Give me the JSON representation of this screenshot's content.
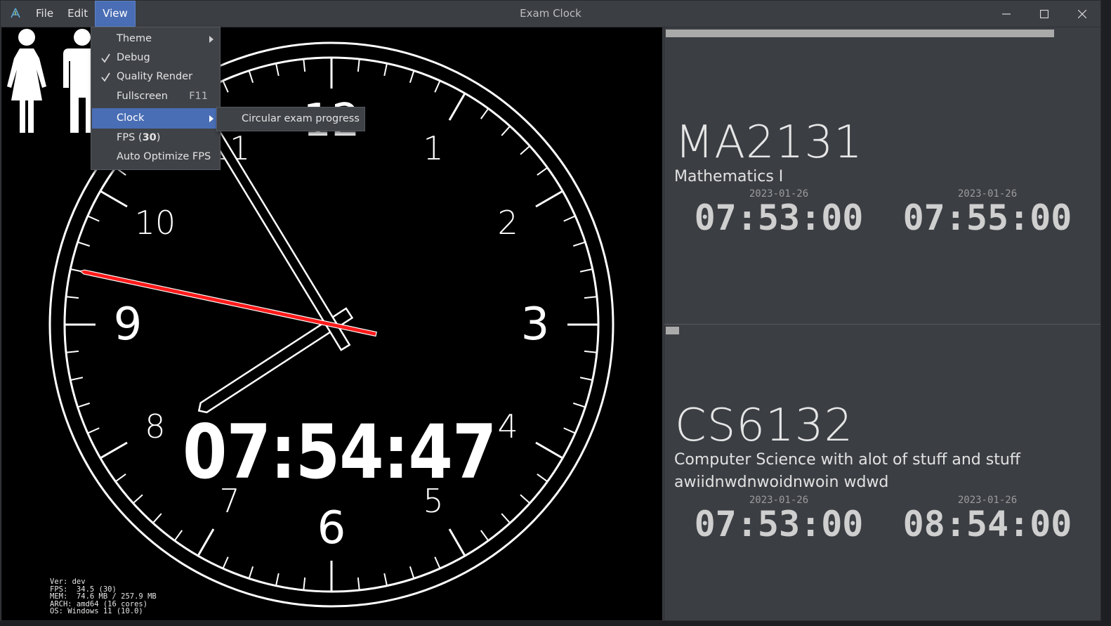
{
  "window": {
    "title": "Exam Clock",
    "icon": "app-logo-icon",
    "controls": [
      "minimize-icon",
      "maximize-icon",
      "close-icon"
    ]
  },
  "menubar": {
    "items": [
      {
        "label": "File"
      },
      {
        "label": "Edit"
      },
      {
        "label": "View",
        "active": true
      }
    ]
  },
  "view_menu": {
    "items": [
      {
        "label": "Theme",
        "checked": false,
        "submenu": true
      },
      {
        "label": "Debug",
        "checked": true
      },
      {
        "label": "Quality Render",
        "checked": true
      },
      {
        "label": "Fullscreen",
        "shortcut": "F11"
      },
      {
        "label": "Clock",
        "submenu": true,
        "highlighted": true
      },
      {
        "label_prefix": "FPS (",
        "label_bold": "30",
        "label_suffix": ")"
      },
      {
        "label": "Auto Optimize FPS"
      }
    ],
    "clock_submenu": {
      "items": [
        {
          "label": "Circular exam progress"
        }
      ]
    }
  },
  "clock": {
    "digital_time": "07:54:47",
    "numerals": [
      "12",
      "1",
      "2",
      "3",
      "4",
      "5",
      "6",
      "7",
      "8",
      "9",
      "10",
      "11"
    ],
    "hour": 7,
    "minute": 54,
    "second": 47,
    "second_hand_color": "#ff1a1a",
    "debug": {
      "version": "Ver: dev",
      "fps": "FPS:  34.5 (30)",
      "mem": "MEM:  74.6 MB / 257.9 MB",
      "arch": "ARCH: amd64 (16 cores)",
      "os": "OS: Windows 11 (10.0)"
    },
    "restroom_icon": "restroom-woman-man-icon"
  },
  "exams": [
    {
      "code": "MA2131",
      "name": "Mathematics I",
      "progress": 0.895,
      "start": {
        "date": "2023-01-26",
        "time": "07:53:00"
      },
      "end": {
        "date": "2023-01-26",
        "time": "07:55:00"
      }
    },
    {
      "code": "CS6132",
      "name": "Computer Science with alot of stuff and stuff awiidnwdnwoidnwoin wdwd",
      "progress": 0.03,
      "start": {
        "date": "2023-01-26",
        "time": "07:53:00"
      },
      "end": {
        "date": "2023-01-26",
        "time": "08:54:00"
      }
    }
  ]
}
